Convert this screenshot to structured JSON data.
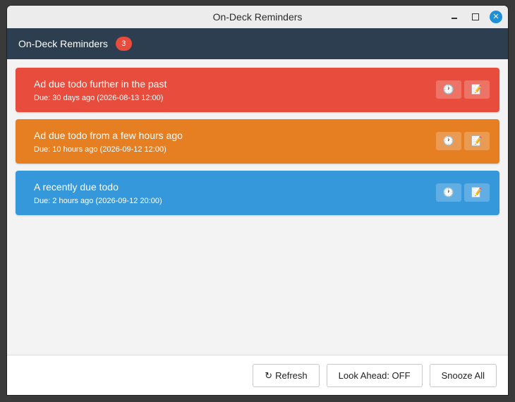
{
  "window": {
    "title": "On-Deck Reminders"
  },
  "header": {
    "title": "On-Deck Reminders",
    "count": "3"
  },
  "reminders": [
    {
      "title": "Ad due todo further in the past",
      "due": "Due: 30 days ago (2026-08-13 12:00)",
      "color": "#e74c3c"
    },
    {
      "title": "Ad due todo from a few hours ago",
      "due": "Due: 10 hours ago (2026-09-12 12:00)",
      "color": "#e67e22"
    },
    {
      "title": "A recently due todo",
      "due": "Due: 2 hours ago (2026-09-12 20:00)",
      "color": "#3498db"
    }
  ],
  "card_buttons": {
    "snooze_icon": "🕐",
    "edit_icon": "📝"
  },
  "footer": {
    "refresh_icon": "↻",
    "refresh_label": "Refresh",
    "look_ahead_label": "Look Ahead: OFF",
    "snooze_all_label": "Snooze All"
  },
  "colors": {
    "header_bg": "#2c3e50",
    "badge": "#e74c3c",
    "close_button": "#1e90d9"
  }
}
